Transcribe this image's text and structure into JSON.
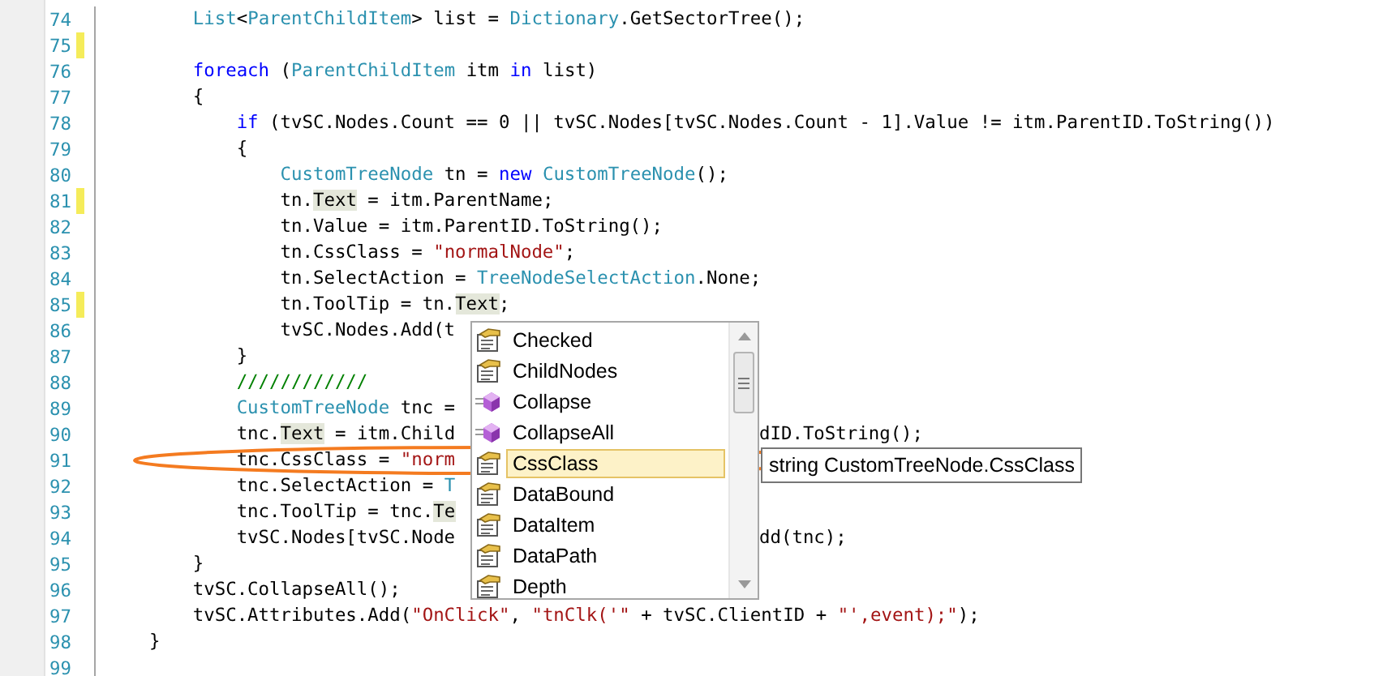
{
  "editor": {
    "lines": [
      {
        "number": "74",
        "changed": false,
        "segments": [
          {
            "text": "        List",
            "kind": "type"
          },
          {
            "text": "<",
            "kind": "plain"
          },
          {
            "text": "ParentChildItem",
            "kind": "type"
          },
          {
            "text": "> list = ",
            "kind": "plain"
          },
          {
            "text": "Dictionary",
            "kind": "type"
          },
          {
            "text": ".GetSectorTree();",
            "kind": "plain"
          }
        ]
      },
      {
        "number": "75",
        "changed": true
      },
      {
        "number": "76",
        "changed": false,
        "segments": [
          {
            "text": "        foreach",
            "kind": "keyword"
          },
          {
            "text": " (",
            "kind": "plain"
          },
          {
            "text": "ParentChildItem",
            "kind": "type"
          },
          {
            "text": " itm ",
            "kind": "plain"
          },
          {
            "text": "in",
            "kind": "keyword"
          },
          {
            "text": " list)",
            "kind": "plain"
          }
        ]
      },
      {
        "number": "77",
        "changed": false,
        "segments": [
          {
            "text": "        {",
            "kind": "plain"
          }
        ]
      },
      {
        "number": "78",
        "changed": false,
        "segments": [
          {
            "text": "            if",
            "kind": "keyword"
          },
          {
            "text": " (tvSC.Nodes.Count == 0 || tvSC.Nodes[tvSC.Nodes.Count - 1].Value != itm.ParentID.ToString())",
            "kind": "plain"
          }
        ]
      },
      {
        "number": "79",
        "changed": false,
        "segments": [
          {
            "text": "            {",
            "kind": "plain"
          }
        ]
      },
      {
        "number": "80",
        "changed": false,
        "segments": [
          {
            "text": "                CustomTreeNode",
            "kind": "type"
          },
          {
            "text": " tn = ",
            "kind": "plain"
          },
          {
            "text": "new",
            "kind": "keyword"
          },
          {
            "text": " CustomTreeNode",
            "kind": "type"
          },
          {
            "text": "();",
            "kind": "plain"
          }
        ]
      },
      {
        "number": "81",
        "changed": true,
        "segments": [
          {
            "text": "                tn.",
            "kind": "plain"
          },
          {
            "text": "Text",
            "kind": "ref"
          },
          {
            "text": " = itm.ParentName;",
            "kind": "plain"
          }
        ]
      },
      {
        "number": "82",
        "changed": false,
        "segments": [
          {
            "text": "                tn.Value = itm.ParentID.ToString();",
            "kind": "plain"
          }
        ]
      },
      {
        "number": "83",
        "changed": false,
        "segments": [
          {
            "text": "                tn.CssClass = ",
            "kind": "plain"
          },
          {
            "text": "\"normalNode\"",
            "kind": "string"
          },
          {
            "text": ";",
            "kind": "plain"
          }
        ]
      },
      {
        "number": "84",
        "changed": false,
        "segments": [
          {
            "text": "                tn.SelectAction = ",
            "kind": "plain"
          },
          {
            "text": "TreeNodeSelectAction",
            "kind": "type"
          },
          {
            "text": ".None;",
            "kind": "plain"
          }
        ]
      },
      {
        "number": "85",
        "changed": true,
        "segments": [
          {
            "text": "                tn.ToolTip = tn.",
            "kind": "plain"
          },
          {
            "text": "Text",
            "kind": "ref"
          },
          {
            "text": ";",
            "kind": "plain"
          }
        ]
      },
      {
        "number": "86",
        "changed": false,
        "segments": [
          {
            "text": "                tvSC.Nodes.Add(t",
            "kind": "plain"
          }
        ]
      },
      {
        "number": "87",
        "changed": false,
        "segments": [
          {
            "text": "            }",
            "kind": "plain"
          }
        ]
      },
      {
        "number": "88",
        "changed": false,
        "segments": [
          {
            "text": "            ////////////",
            "kind": "comment"
          }
        ]
      },
      {
        "number": "89",
        "changed": false,
        "segments": [
          {
            "text": "            CustomTreeNode",
            "kind": "type"
          },
          {
            "text": " tnc =",
            "kind": "plain"
          }
        ]
      },
      {
        "number": "90",
        "changed": false,
        "segments": [
          {
            "text": "            tnc.",
            "kind": "plain"
          },
          {
            "text": "Text",
            "kind": "ref"
          },
          {
            "text": " = itm.Child",
            "kind": "plain"
          }
        ],
        "tail": "dID.ToString();"
      },
      {
        "number": "91",
        "changed": false,
        "segments": [
          {
            "text": "            tnc.CssClass = ",
            "kind": "plain"
          },
          {
            "text": "\"norm",
            "kind": "string"
          }
        ]
      },
      {
        "number": "92",
        "changed": false,
        "segments": [
          {
            "text": "            tnc.SelectAction = ",
            "kind": "plain"
          },
          {
            "text": "T",
            "kind": "type"
          }
        ]
      },
      {
        "number": "93",
        "changed": false,
        "segments": [
          {
            "text": "            tnc.ToolTip = tnc.",
            "kind": "plain"
          },
          {
            "text": "Te",
            "kind": "ref"
          }
        ]
      },
      {
        "number": "94",
        "changed": false,
        "segments": [
          {
            "text": "            tvSC.Nodes[tvSC.Node",
            "kind": "plain"
          }
        ],
        "tail": "dd(tnc);"
      },
      {
        "number": "95",
        "changed": false,
        "segments": [
          {
            "text": "        }",
            "kind": "plain"
          }
        ]
      },
      {
        "number": "96",
        "changed": false,
        "segments": [
          {
            "text": "        tvSC.CollapseAll();",
            "kind": "plain"
          }
        ]
      },
      {
        "number": "97",
        "changed": false,
        "segments": [
          {
            "text": "        tvSC.Attributes.Add(",
            "kind": "plain"
          },
          {
            "text": "\"OnClick\"",
            "kind": "string"
          },
          {
            "text": ", ",
            "kind": "plain"
          },
          {
            "text": "\"tnClk('\"",
            "kind": "string"
          },
          {
            "text": " + tvSC.ClientID + ",
            "kind": "plain"
          },
          {
            "text": "\"',event);\"",
            "kind": "string"
          },
          {
            "text": ");",
            "kind": "plain"
          }
        ]
      },
      {
        "number": "98",
        "changed": false,
        "segments": [
          {
            "text": "    }",
            "kind": "plain"
          }
        ]
      },
      {
        "number": "99",
        "changed": false
      }
    ]
  },
  "completion_list": {
    "items": [
      {
        "label": "Checked",
        "kind": "property",
        "selected": false
      },
      {
        "label": "ChildNodes",
        "kind": "property",
        "selected": false
      },
      {
        "label": "Collapse",
        "kind": "method",
        "selected": false
      },
      {
        "label": "CollapseAll",
        "kind": "method",
        "selected": false
      },
      {
        "label": "CssClass",
        "kind": "property",
        "selected": true
      },
      {
        "label": "DataBound",
        "kind": "property",
        "selected": false
      },
      {
        "label": "DataItem",
        "kind": "property",
        "selected": false
      },
      {
        "label": "DataPath",
        "kind": "property",
        "selected": false
      },
      {
        "label": "Depth",
        "kind": "property",
        "selected": false
      }
    ]
  },
  "tooltip": {
    "text": "string CustomTreeNode.CssClass"
  }
}
